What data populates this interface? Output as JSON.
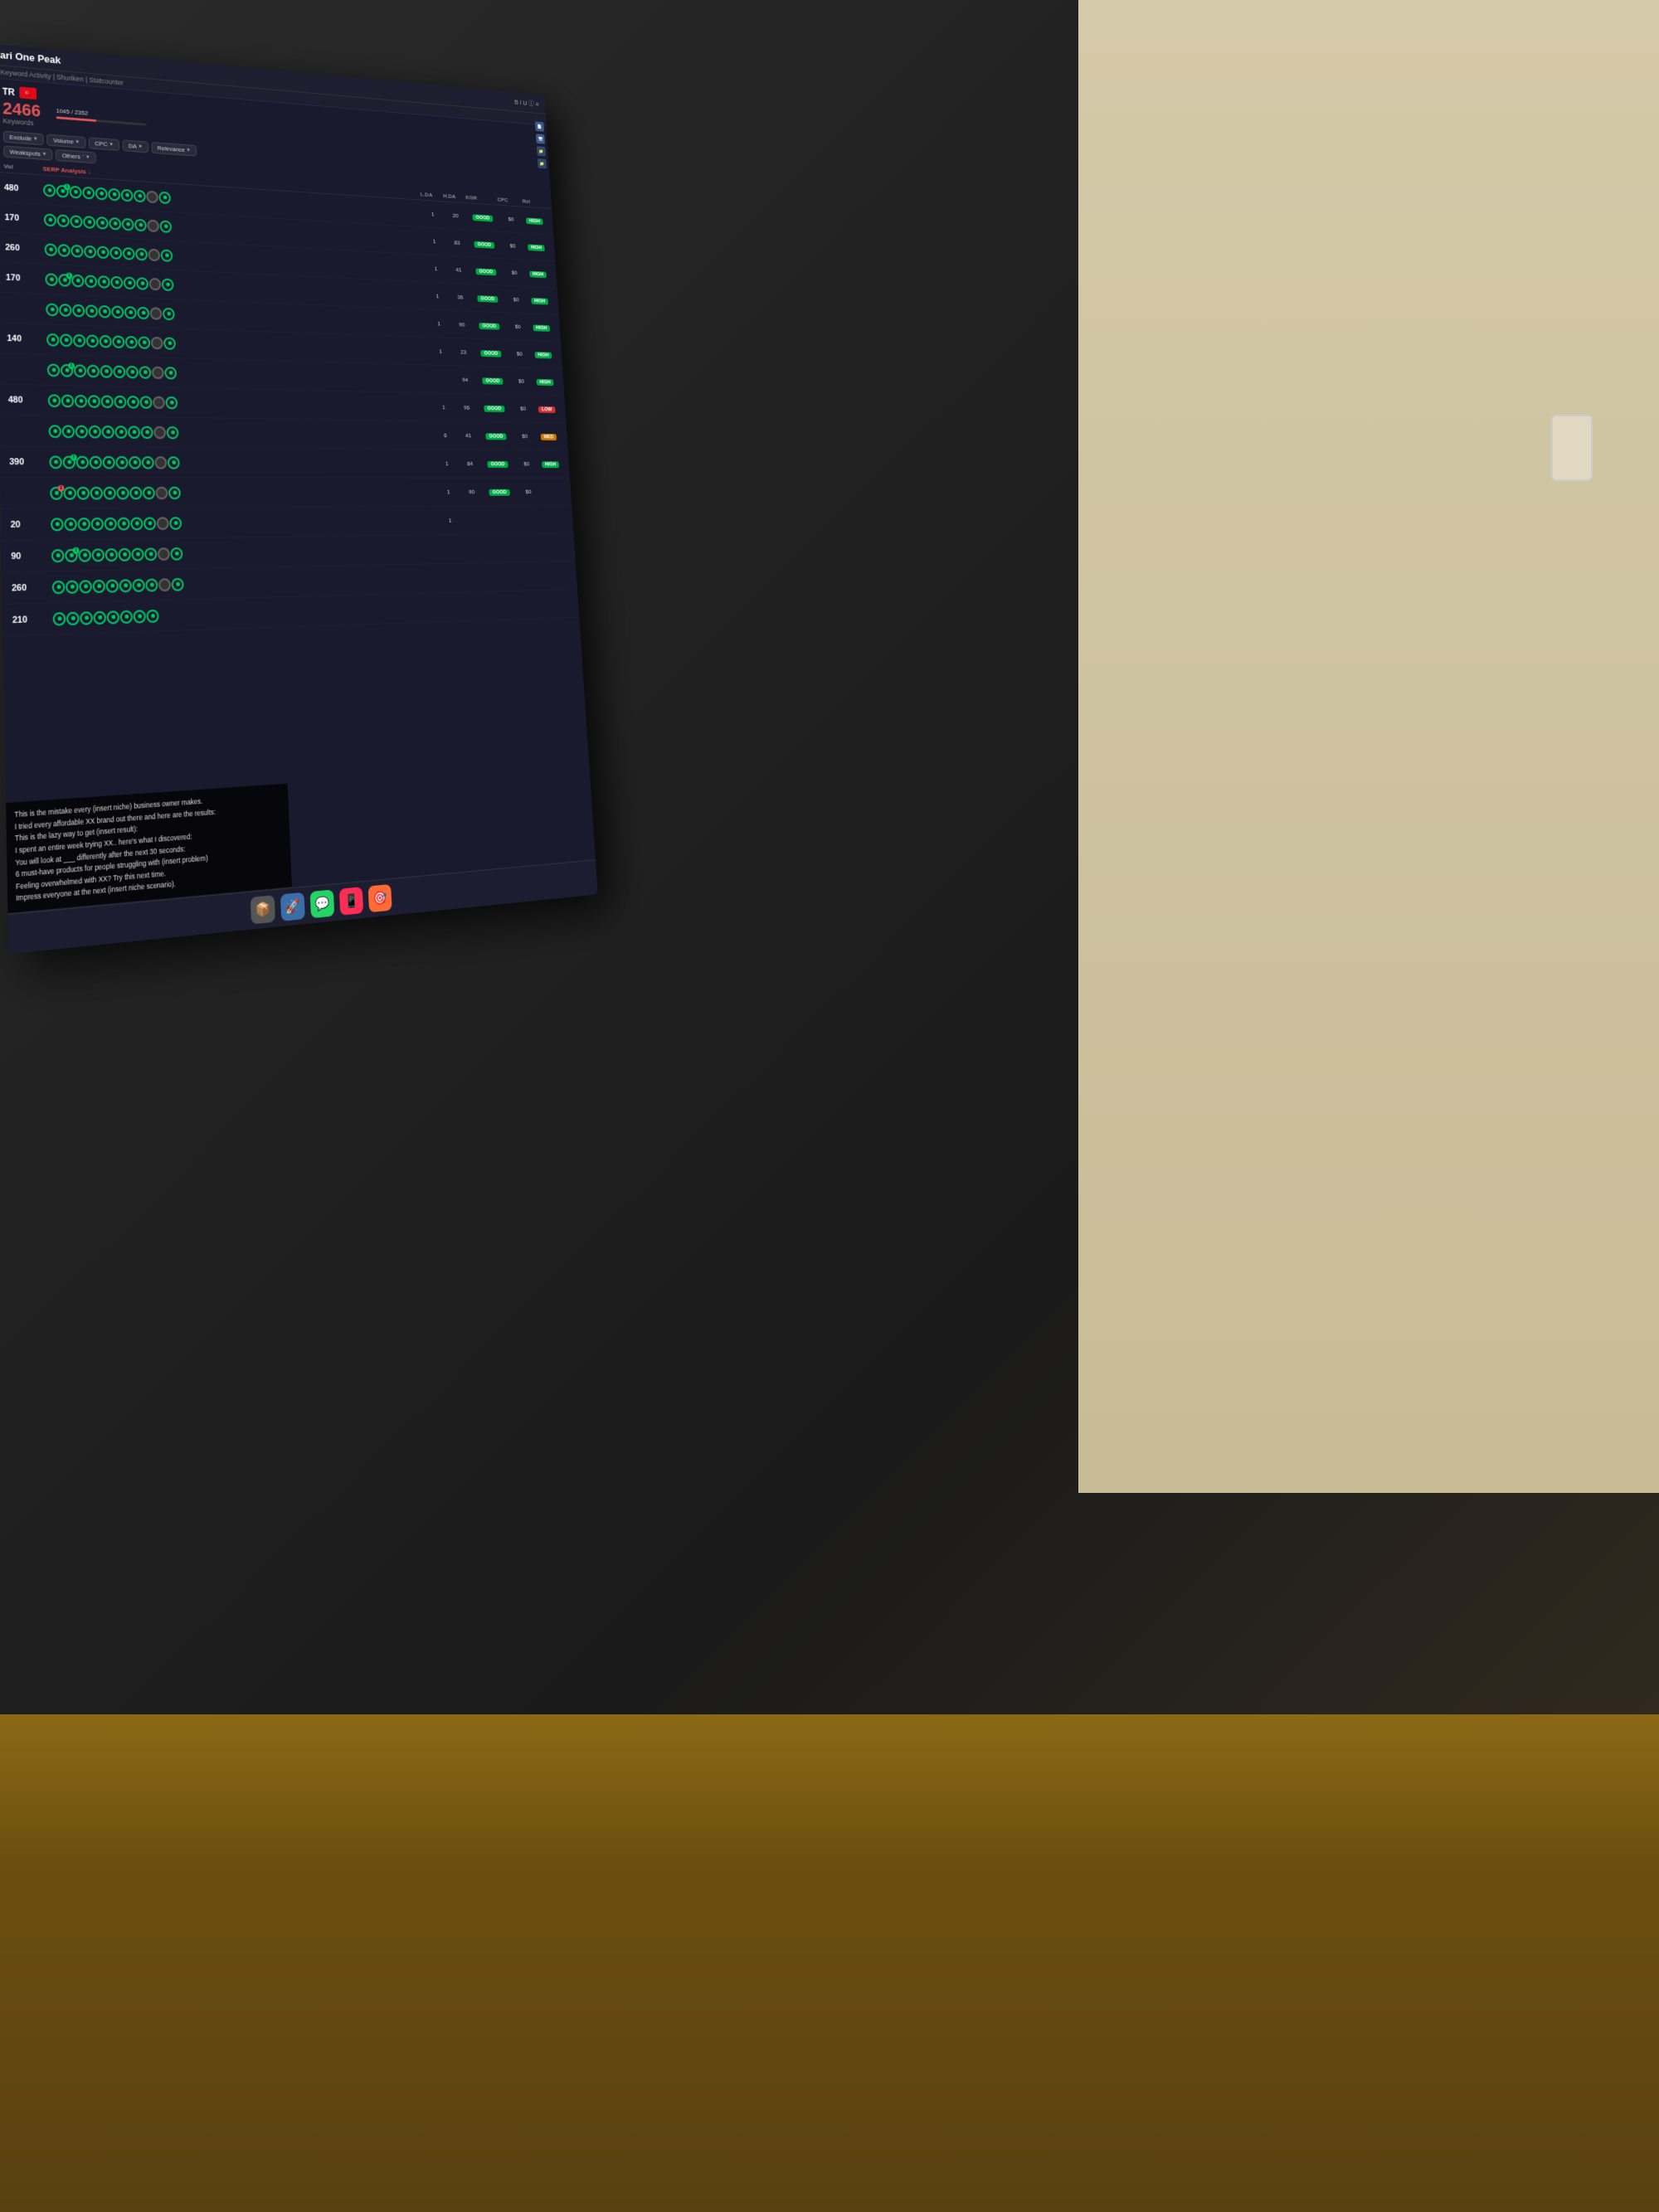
{
  "app": {
    "title": "ari One Peak",
    "breadcrumb": "Keyword Activity | Shuriken | Statcounter"
  },
  "header": {
    "country_code": "TR",
    "flag_emoji": "🇹🇷",
    "keyword_count": "2466",
    "keyword_label": "Keywords",
    "progress": "1045 / 2352",
    "progress_percent": 44
  },
  "filters": [
    {
      "label": "Exclude",
      "active": false
    },
    {
      "label": "Volume",
      "active": false
    },
    {
      "label": "CPC",
      "active": false
    },
    {
      "label": "DA",
      "active": false
    },
    {
      "label": "Relevance",
      "active": false
    },
    {
      "label": "Weakspots",
      "active": false
    },
    {
      "label": "Others `",
      "active": false
    }
  ],
  "columns": {
    "vol": "Vol",
    "serp": "SERP Analysis ↓",
    "lda": "L.DA",
    "hda": "H.DA",
    "kgr": "KGR",
    "cpc": "CPC",
    "rel": "Rel"
  },
  "rows": [
    {
      "vol": "480",
      "lda": "1",
      "hda": "20",
      "kgr": "GOOD",
      "cpc": "$0",
      "rel": "HIGH",
      "circles": 10
    },
    {
      "vol": "170",
      "lda": "1",
      "hda": "83",
      "kgr": "GOOD",
      "cpc": "$0",
      "rel": "HIGH",
      "circles": 10
    },
    {
      "vol": "260",
      "lda": "1",
      "hda": "41",
      "kgr": "GOOD",
      "cpc": "$0",
      "rel": "HIGH",
      "circles": 10
    },
    {
      "vol": "170",
      "lda": "1",
      "hda": "36",
      "kgr": "GOOD",
      "cpc": "$0",
      "rel": "HIGH",
      "circles": 10
    },
    {
      "vol": "",
      "lda": "1",
      "hda": "90",
      "kgr": "GOOD",
      "cpc": "$0",
      "rel": "HIGH",
      "circles": 10
    },
    {
      "vol": "140",
      "lda": "1",
      "hda": "23",
      "kgr": "GOOD",
      "cpc": "$0",
      "rel": "HIGH",
      "circles": 10
    },
    {
      "vol": "",
      "lda": "",
      "hda": "94",
      "kgr": "GOOD",
      "cpc": "$0",
      "rel": "HIGH",
      "circles": 10
    },
    {
      "vol": "480",
      "lda": "1",
      "hda": "96",
      "kgr": "GOOD",
      "cpc": "$0",
      "rel": "LOW",
      "circles": 10
    },
    {
      "vol": "",
      "lda": "6",
      "hda": "41",
      "kgr": "GOOD",
      "cpc": "$0",
      "rel": "MED",
      "circles": 10
    },
    {
      "vol": "390",
      "lda": "1",
      "hda": "84",
      "kgr": "GOOD",
      "cpc": "$0",
      "rel": "HIGH",
      "circles": 10
    },
    {
      "vol": "",
      "lda": "1",
      "hda": "90",
      "kgr": "GOOD",
      "cpc": "$0",
      "rel": "",
      "circles": 10
    },
    {
      "vol": "20",
      "lda": "1",
      "hda": "",
      "kgr": "",
      "cpc": "",
      "rel": "",
      "circles": 10
    },
    {
      "vol": "90",
      "lda": "",
      "hda": "",
      "kgr": "",
      "cpc": "",
      "rel": "",
      "circles": 10
    },
    {
      "vol": "260",
      "lda": "",
      "hda": "",
      "kgr": "",
      "cpc": "",
      "rel": "",
      "circles": 10
    },
    {
      "vol": "210",
      "lda": "",
      "hda": "",
      "kgr": "",
      "cpc": "",
      "rel": "",
      "circles": 8
    }
  ],
  "overlay_text": [
    "This is the mistake every (insert niche) business owner makes.",
    "I tried every affordable XX brand out there and here are the results:",
    "This is the lazy way to get (insert result):",
    "I spent an entire week trying XX.. here's what I discovered:",
    "You will look at ___ differently after the next 30 seconds:",
    "6 must-have products for people struggling with (insert problem)",
    "Feeling overwhelmed with XX? Try this next time.",
    "Impress everyone at the next (insert niche scenario)."
  ],
  "dock": [
    {
      "label": "📦",
      "name": "dock-files"
    },
    {
      "label": "🚀",
      "name": "dock-launch"
    },
    {
      "label": "💬",
      "name": "dock-messages"
    },
    {
      "label": "📱",
      "name": "dock-phone"
    },
    {
      "label": "🎯",
      "name": "dock-target"
    }
  ],
  "colors": {
    "accent_red": "#e05555",
    "accent_green": "#00cc66",
    "bg_dark": "#1a1a2e",
    "bg_medium": "#1e1e30",
    "text_primary": "#ffffff",
    "text_secondary": "#888888"
  }
}
